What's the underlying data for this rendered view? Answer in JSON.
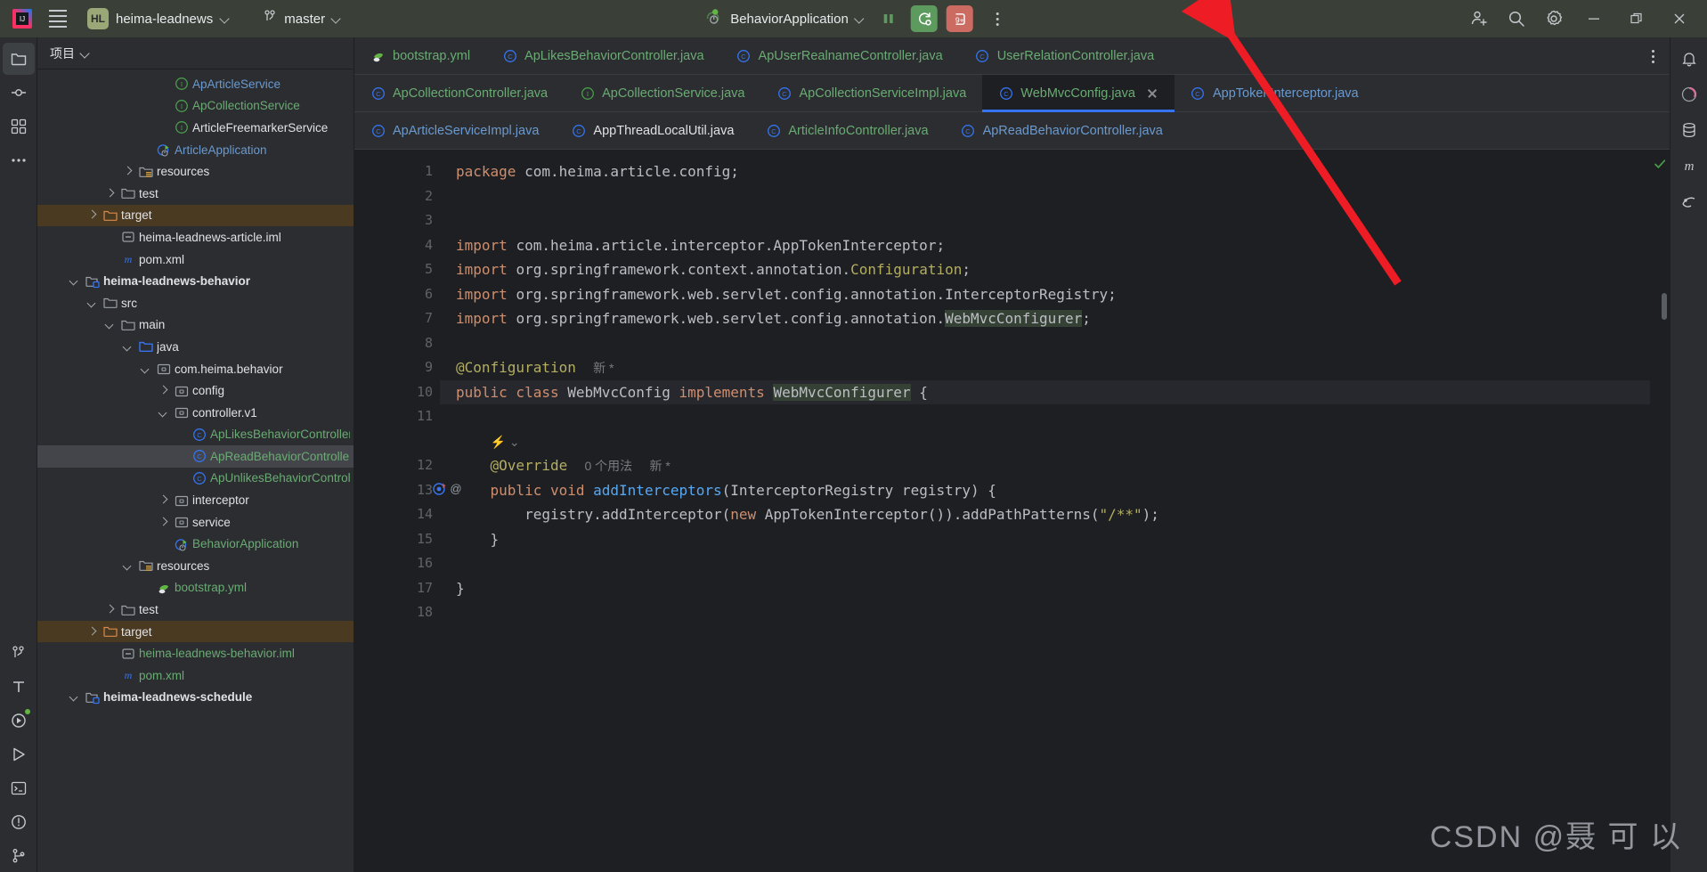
{
  "titlebar": {
    "app_icon": "intellij-idea-logo",
    "menu_icon": "hamburger-menu-icon",
    "project_badge": "HL",
    "project_name": "heima-leadnews",
    "branch_icon": "git-branch-icon",
    "branch_name": "master",
    "run_config_icon": "run-config-spring-icon",
    "run_config_name": "BehaviorApplication",
    "pause_label": "pause-icon",
    "rerun_label": "rerun-with-settings-icon",
    "debug_label": "debug-9-plus-icon",
    "more_label": "more-options-icon",
    "share_label": "add-collaborator-icon",
    "search_label": "search-icon",
    "settings_label": "settings-gear-icon",
    "minimize_label": "minimize-icon",
    "maximize_label": "restore-icon",
    "close_label": "close-icon",
    "accent_green": "#5d9a5e",
    "accent_red": "#cc6b61",
    "badge_green": "#9aa776"
  },
  "left_rail": {
    "items": [
      {
        "name": "project-tool-window",
        "icon": "folder-icon",
        "active": true
      },
      {
        "name": "commit-tool-window",
        "icon": "commit-icon",
        "active": false
      },
      {
        "name": "structure-tool-window",
        "icon": "structure-icon",
        "active": false
      },
      {
        "name": "more-tool-windows",
        "icon": "ellipsis-icon",
        "active": false
      }
    ],
    "bottom_items": [
      {
        "name": "version-control-tool-window",
        "icon": "branch-icon"
      },
      {
        "name": "todo-tool-window",
        "icon": "t-letter-icon"
      },
      {
        "name": "services-tool-window",
        "icon": "play-circle-icon",
        "badge": true
      },
      {
        "name": "run-tool-window",
        "icon": "play-icon"
      },
      {
        "name": "terminal-tool-window",
        "icon": "terminal-icon"
      },
      {
        "name": "problems-tool-window",
        "icon": "warning-circle-icon"
      },
      {
        "name": "git-tool-window",
        "icon": "git-icon"
      }
    ]
  },
  "project_panel": {
    "title": "项目",
    "chevron": "chevron-down-icon",
    "tree": [
      {
        "indent": 6,
        "arrow": "none",
        "icon": "interface-icon",
        "label": "ApArticleService",
        "color": "blue"
      },
      {
        "indent": 6,
        "arrow": "none",
        "icon": "interface-icon",
        "label": "ApCollectionService",
        "color": "green"
      },
      {
        "indent": 6,
        "arrow": "none",
        "icon": "interface-icon",
        "label": "ArticleFreemarkerService",
        "color": "white"
      },
      {
        "indent": 5,
        "arrow": "none",
        "icon": "spring-app-icon",
        "label": "ArticleApplication",
        "color": "blue"
      },
      {
        "indent": 4,
        "arrow": "right",
        "icon": "resources-folder-icon",
        "label": "resources",
        "color": "white"
      },
      {
        "indent": 3,
        "arrow": "right",
        "icon": "folder-icon",
        "label": "test",
        "color": "white"
      },
      {
        "indent": 2,
        "arrow": "right",
        "icon": "target-folder-icon",
        "label": "target",
        "color": "white",
        "highlight": "target"
      },
      {
        "indent": 3,
        "arrow": "none",
        "icon": "iml-icon",
        "label": "heima-leadnews-article.iml",
        "color": "white"
      },
      {
        "indent": 3,
        "arrow": "none",
        "icon": "maven-icon",
        "label": "pom.xml",
        "color": "white"
      },
      {
        "indent": 1,
        "arrow": "down",
        "icon": "module-icon",
        "label": "heima-leadnews-behavior",
        "color": "white",
        "bold": true
      },
      {
        "indent": 2,
        "arrow": "down",
        "icon": "folder-icon",
        "label": "src",
        "color": "white"
      },
      {
        "indent": 3,
        "arrow": "down",
        "icon": "folder-icon",
        "label": "main",
        "color": "white"
      },
      {
        "indent": 4,
        "arrow": "down",
        "icon": "sources-folder-icon",
        "label": "java",
        "color": "white"
      },
      {
        "indent": 5,
        "arrow": "down",
        "icon": "package-icon",
        "label": "com.heima.behavior",
        "color": "white"
      },
      {
        "indent": 6,
        "arrow": "right",
        "icon": "package-icon",
        "label": "config",
        "color": "white"
      },
      {
        "indent": 6,
        "arrow": "down",
        "icon": "package-icon",
        "label": "controller.v1",
        "color": "white"
      },
      {
        "indent": 7,
        "arrow": "none",
        "icon": "class-icon",
        "label": "ApLikesBehaviorController",
        "color": "green"
      },
      {
        "indent": 7,
        "arrow": "none",
        "icon": "class-icon",
        "label": "ApReadBehaviorController",
        "color": "green",
        "selected": true
      },
      {
        "indent": 7,
        "arrow": "none",
        "icon": "class-icon",
        "label": "ApUnlikesBehaviorController",
        "color": "green"
      },
      {
        "indent": 6,
        "arrow": "right",
        "icon": "package-icon",
        "label": "interceptor",
        "color": "white"
      },
      {
        "indent": 6,
        "arrow": "right",
        "icon": "package-icon",
        "label": "service",
        "color": "white"
      },
      {
        "indent": 6,
        "arrow": "none",
        "icon": "spring-app-icon",
        "label": "BehaviorApplication",
        "color": "green"
      },
      {
        "indent": 4,
        "arrow": "down",
        "icon": "resources-folder-icon",
        "label": "resources",
        "color": "white"
      },
      {
        "indent": 5,
        "arrow": "none",
        "icon": "yaml-spring-icon",
        "label": "bootstrap.yml",
        "color": "green"
      },
      {
        "indent": 3,
        "arrow": "right",
        "icon": "folder-icon",
        "label": "test",
        "color": "white"
      },
      {
        "indent": 2,
        "arrow": "right",
        "icon": "target-folder-icon",
        "label": "target",
        "color": "white",
        "highlight": "target"
      },
      {
        "indent": 3,
        "arrow": "none",
        "icon": "iml-icon",
        "label": "heima-leadnews-behavior.iml",
        "color": "green"
      },
      {
        "indent": 3,
        "arrow": "none",
        "icon": "maven-icon",
        "label": "pom.xml",
        "color": "green"
      },
      {
        "indent": 1,
        "arrow": "down",
        "icon": "module-icon",
        "label": "heima-leadnews-schedule",
        "color": "white",
        "bold": true
      }
    ]
  },
  "editor": {
    "tab_rows": [
      [
        {
          "label": "bootstrap.yml",
          "icon": "yaml-spring-icon",
          "color": "green",
          "active": false
        },
        {
          "label": "ApLikesBehaviorController.java",
          "icon": "class-icon",
          "color": "green",
          "active": false
        },
        {
          "label": "ApUserRealnameController.java",
          "icon": "class-icon",
          "color": "green",
          "active": false
        },
        {
          "label": "UserRelationController.java",
          "icon": "class-icon",
          "color": "green",
          "active": false
        }
      ],
      [
        {
          "label": "ApCollectionController.java",
          "icon": "class-icon",
          "color": "green",
          "active": false
        },
        {
          "label": "ApCollectionService.java",
          "icon": "interface-icon",
          "color": "green",
          "active": false
        },
        {
          "label": "ApCollectionServiceImpl.java",
          "icon": "class-icon",
          "color": "green",
          "active": false
        },
        {
          "label": "WebMvcConfig.java",
          "icon": "class-icon",
          "color": "green",
          "active": true,
          "closable": true
        },
        {
          "label": "AppTokenInterceptor.java",
          "icon": "class-icon",
          "color": "blue",
          "active": false
        }
      ],
      [
        {
          "label": "ApArticleServiceImpl.java",
          "icon": "class-icon",
          "color": "blue",
          "active": false
        },
        {
          "label": "AppThreadLocalUtil.java",
          "icon": "class-icon",
          "color": "white",
          "active": false
        },
        {
          "label": "ArticleInfoController.java",
          "icon": "class-icon",
          "color": "green",
          "active": false
        },
        {
          "label": "ApReadBehaviorController.java",
          "icon": "class-icon",
          "color": "blue",
          "active": false
        }
      ]
    ],
    "tabs_kebab": "tab-list-options-icon",
    "line_numbers": [
      "1",
      "2",
      "3",
      "4",
      "5",
      "6",
      "7",
      "8",
      "9",
      "10",
      "11",
      "12",
      "13",
      "14",
      "15",
      "16",
      "17",
      "18"
    ],
    "code_lines": [
      {
        "n": 1,
        "html": "<span class=\"kw\">package</span> <span class=\"pl\">com.heima.article.config;</span>"
      },
      {
        "n": 2,
        "html": ""
      },
      {
        "n": 3,
        "html": ""
      },
      {
        "n": 4,
        "html": "<span class=\"kw\">import</span> <span class=\"pl\">com.heima.article.interceptor.AppTokenInterceptor;</span>"
      },
      {
        "n": 5,
        "html": "<span class=\"kw\">import</span> <span class=\"pl\">org.springframework.context.annotation.</span><span class=\"ann\">Configuration</span><span class=\"pl\">;</span>"
      },
      {
        "n": 6,
        "html": "<span class=\"kw\">import</span> <span class=\"pl\">org.springframework.web.servlet.config.annotation.InterceptorRegistry;</span>"
      },
      {
        "n": 7,
        "html": "<span class=\"kw\">import</span> <span class=\"pl\">org.springframework.web.servlet.config.annotation.</span><span class=\"pl hl-ident\">WebMvcConfigurer</span><span class=\"pl\">;</span>"
      },
      {
        "n": 8,
        "html": ""
      },
      {
        "n": 9,
        "html": "<span class=\"ann\">@Configuration</span>  <span class=\"hint\">新 *</span>"
      },
      {
        "n": 10,
        "html": "<span class=\"kw\">public class</span> <span class=\"pl\">WebMvcConfig</span> <span class=\"kw\">implements</span> <span class=\"pl hl-ident\">WebMvcConfigurer</span> <span class=\"pl\">{</span>",
        "current": true
      },
      {
        "n": 11,
        "html": ""
      },
      {
        "n": "",
        "html": "    <span class=\"hint inlay-icon\">⚡ ⌄</span>",
        "inlay": true
      },
      {
        "n": 12,
        "html": "    <span class=\"ann\">@Override</span>  <span class=\"hint\">0 个用法</span>  <span class=\"hint\">新 *</span>"
      },
      {
        "n": 13,
        "html": "    <span class=\"kw\">public void</span> <span class=\"mth\">addInterceptors</span><span class=\"pl\">(InterceptorRegistry registry) {</span>"
      },
      {
        "n": 14,
        "html": "        <span class=\"pl\">registry.addInterceptor(</span><span class=\"kw\">new</span><span class=\"pl\"> AppTokenInterceptor()).addPathPatterns(</span><span class=\"ann\">\"/**\"</span><span class=\"pl\">);</span>"
      },
      {
        "n": 15,
        "html": "    <span class=\"pl\">}</span>"
      },
      {
        "n": 16,
        "html": ""
      },
      {
        "n": 17,
        "html": "<span class=\"pl\">}</span>"
      },
      {
        "n": 18,
        "html": ""
      }
    ],
    "gutter_marks": {
      "line_10": "class-run-mark-icon",
      "line_13": "override-method-icon"
    },
    "inspection_status": "no-problems-check-icon"
  },
  "right_rail": {
    "items": [
      {
        "name": "notifications-tool-window",
        "icon": "bell-icon"
      },
      {
        "name": "ai-assistant-tool-window",
        "icon": "ai-icon"
      },
      {
        "name": "database-tool-window",
        "icon": "database-icon"
      },
      {
        "name": "maven-tool-window",
        "icon": "m-letter-icon"
      },
      {
        "name": "gradle-tool-window",
        "icon": "elephant-icon"
      }
    ]
  },
  "watermark": {
    "text": "CSDN @聂 可 以"
  },
  "annotation": {
    "arrow_color": "#ee1c25",
    "points_to": "BehaviorApplication run configuration selector"
  }
}
